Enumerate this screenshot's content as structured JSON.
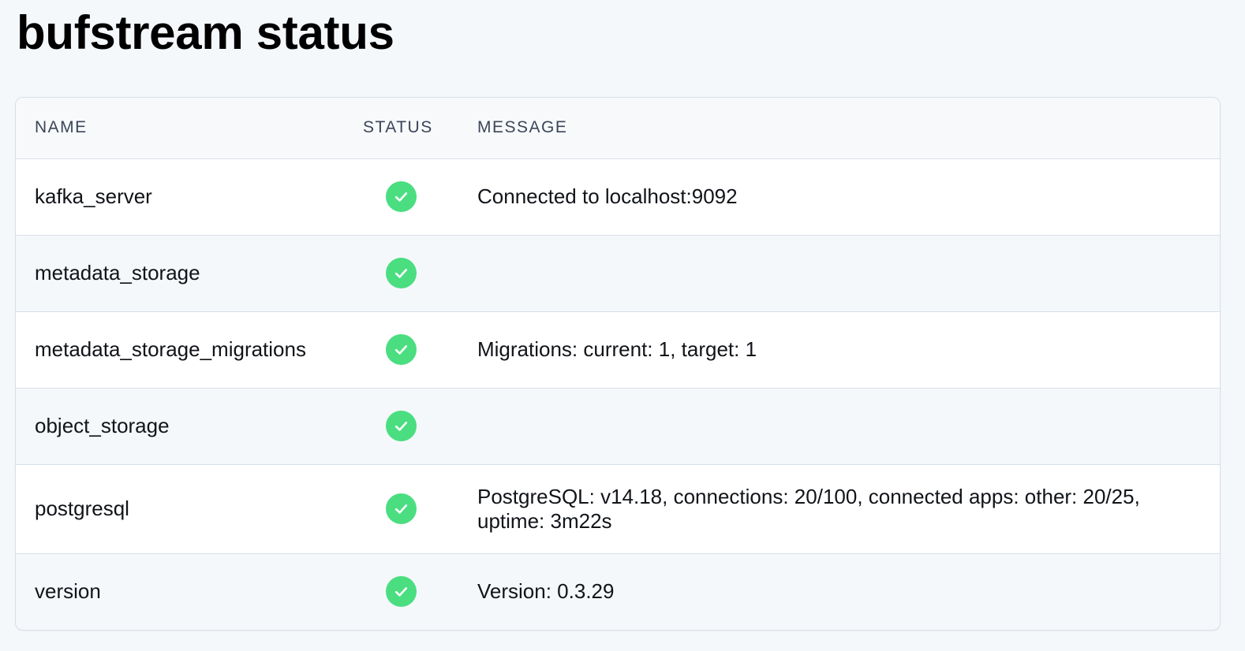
{
  "page": {
    "title": "bufstream status"
  },
  "table": {
    "headers": {
      "name": "NAME",
      "status": "STATUS",
      "message": "MESSAGE"
    },
    "rows": [
      {
        "name": "kafka_server",
        "status": "ok",
        "status_icon": "check-circle-icon",
        "message": "Connected to localhost:9092"
      },
      {
        "name": "metadata_storage",
        "status": "ok",
        "status_icon": "check-circle-icon",
        "message": ""
      },
      {
        "name": "metadata_storage_migrations",
        "status": "ok",
        "status_icon": "check-circle-icon",
        "message": "Migrations: current: 1, target: 1"
      },
      {
        "name": "object_storage",
        "status": "ok",
        "status_icon": "check-circle-icon",
        "message": ""
      },
      {
        "name": "postgresql",
        "status": "ok",
        "status_icon": "check-circle-icon",
        "message": "PostgreSQL: v14.18, connections: 20/100, connected apps: other: 20/25, uptime: 3m22s"
      },
      {
        "name": "version",
        "status": "ok",
        "status_icon": "check-circle-icon",
        "message": "Version: 0.3.29"
      }
    ]
  },
  "colors": {
    "page_background": "#f5f8fb",
    "status_ok": "#4ade80",
    "border": "#d8dfe7",
    "header_text": "#3a4658"
  }
}
